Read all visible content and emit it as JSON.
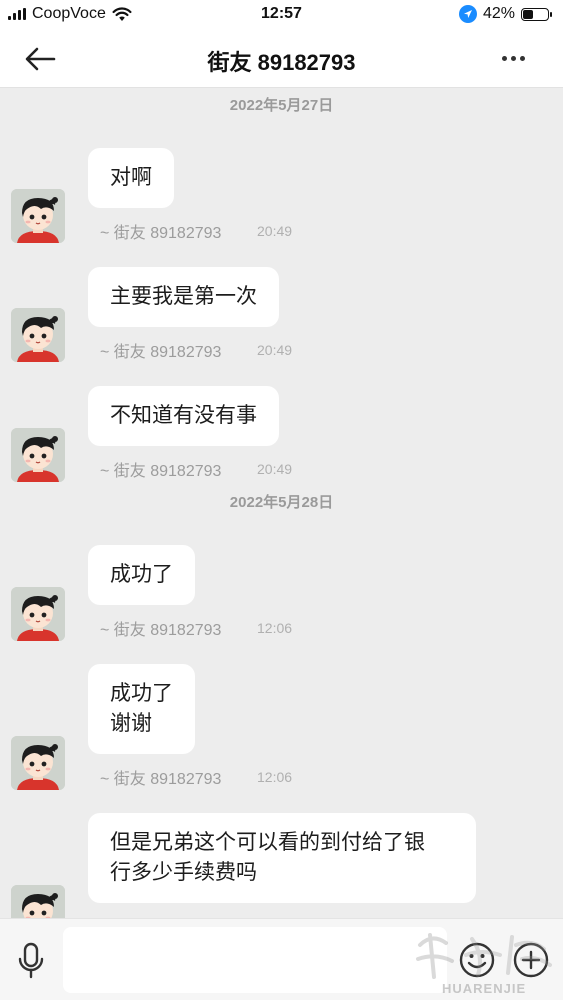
{
  "status_bar": {
    "carrier": "CoopVoce",
    "time": "12:57",
    "battery_percent": "42%",
    "battery_level": 0.42,
    "icons": [
      "signal-icon",
      "wifi-icon",
      "location-arrow-icon",
      "battery-icon"
    ]
  },
  "header": {
    "title": "街友 89182793",
    "back_icon": "arrow-left-icon",
    "more_icon": "more-dots-icon"
  },
  "conversation": {
    "dates": [
      "2022年5月27日",
      "2022年5月28日"
    ],
    "messages": [
      {
        "lines": [
          "对啊"
        ],
        "sender": "~ 街友 89182793",
        "time": "20:49"
      },
      {
        "lines": [
          "主要我是第一次"
        ],
        "sender": "~ 街友 89182793",
        "time": "20:49"
      },
      {
        "lines": [
          "不知道有没有事"
        ],
        "sender": "~ 街友 89182793",
        "time": "20:49"
      },
      {
        "lines": [
          "成功了"
        ],
        "sender": "~ 街友 89182793",
        "time": "12:06"
      },
      {
        "lines": [
          "成功了",
          "谢谢"
        ],
        "sender": "~ 街友 89182793",
        "time": "12:06"
      },
      {
        "lines": [
          "但是兄弟这个可以看的到付给了银",
          "行多少手续费吗"
        ],
        "sender": "",
        "time": ""
      }
    ]
  },
  "composer": {
    "input_value": "",
    "mic_icon": "microphone-icon",
    "emoji_icon": "smiley-icon",
    "plus_icon": "plus-circle-icon",
    "watermark_text": "HUARENJIE"
  },
  "colors": {
    "background": "#ededed",
    "bubble": "#ffffff",
    "secondary_text": "#9c9c9c",
    "location_blue": "#1a8cff"
  }
}
